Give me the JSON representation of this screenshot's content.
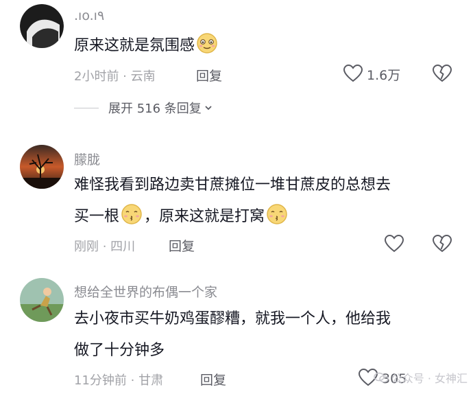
{
  "comments": [
    {
      "username": ".ıo.ı٩",
      "text_parts": [
        "原来这就是氛围感"
      ],
      "time_location": "2小时前 · 云南",
      "reply_label": "回复",
      "like_count": "1.6万",
      "expand_label": "展开 516 条回复"
    },
    {
      "username": "朦胧",
      "line1": "难怪我看到路边卖甘蔗摊位一堆甘蔗皮的总想去",
      "line2_a": "买一根",
      "line2_b": "，原来这就是打窝",
      "time_location": "刚刚 · 四川",
      "reply_label": "回复"
    },
    {
      "username": "想给全世界的布偶一个家",
      "line1": "去小夜市买牛奶鸡蛋醪糟，就我一个人，他给我",
      "line2": "做了十分钟多",
      "time_location": "11分钟前 · 甘肃",
      "reply_label": "回复",
      "like_count": "305"
    }
  ],
  "watermark": "公众号 · 女神汇",
  "icons": {
    "like": "heart-outline-icon",
    "dislike": "broken-heart-icon",
    "expand": "chevron-down-icon",
    "emoji_1": "blushing-smile-emoji",
    "emoji_2": "kiss-emoji"
  },
  "colors": {
    "text": "#161823",
    "meta": "#a1a2a7",
    "username": "#8a8b91",
    "action": "#5a5b63"
  }
}
